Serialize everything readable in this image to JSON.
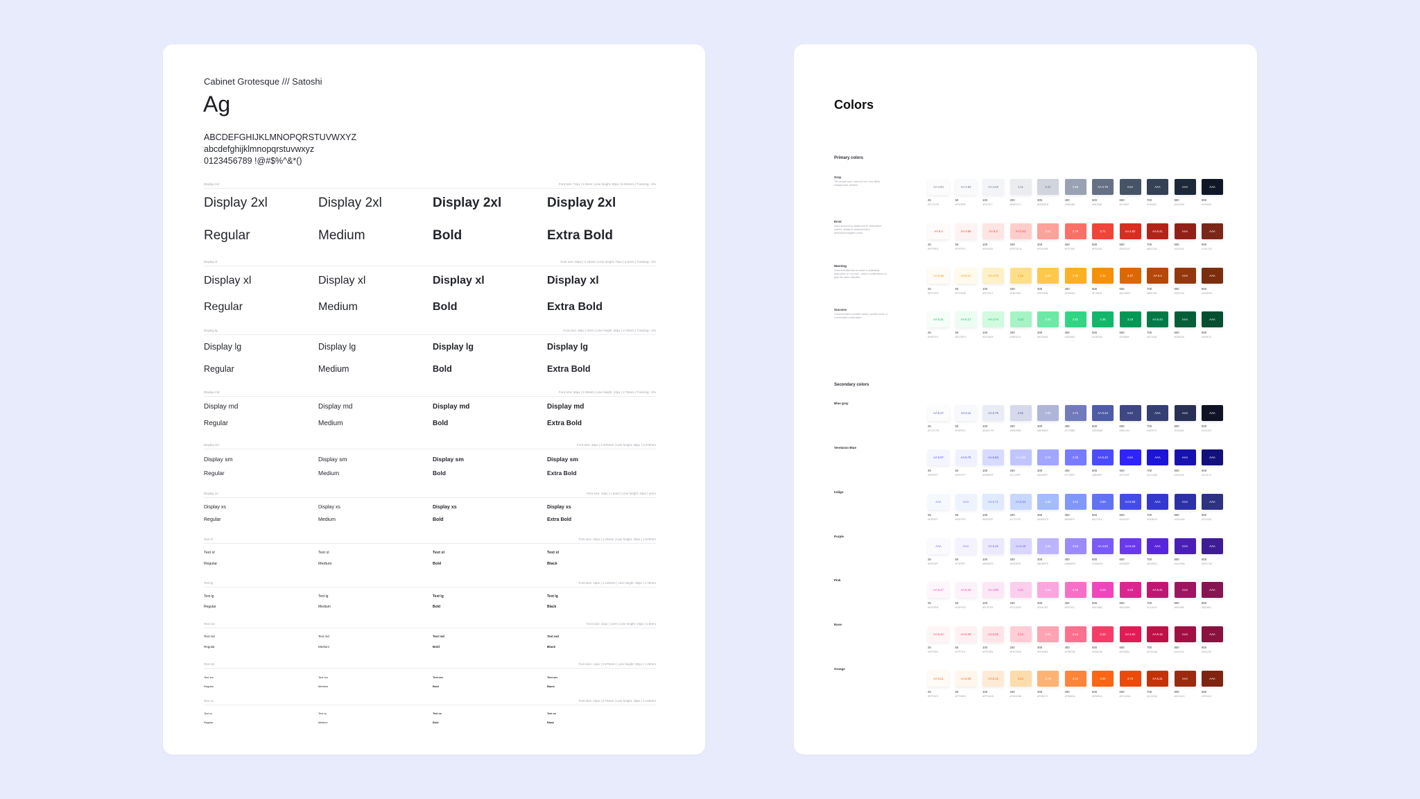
{
  "typography": {
    "font_names": "Cabinet Grotesque /// Satoshi",
    "ag": "Ag",
    "uppercase": "ABCDEFGHIJKLMNOPQRSTUVWXYZ",
    "lowercase": "abcdefghijklmnopqrstuvwxyz",
    "numerals": "0123456789 !@#$%^&*()",
    "specimens": [
      {
        "label": "Display 2xl",
        "meta": "Font size: 72px | 4.5rem | Line height: 90px | 5.625rem | Tracking: -2%",
        "sample": "Display 2xl",
        "weights": [
          "Regular",
          "Medium",
          "Bold",
          "Extra Bold"
        ]
      },
      {
        "label": "Display xl",
        "meta": "Font size: 60px | 3.75rem | Line height: 72px | 4.5rem | Tracking: -2%",
        "sample": "Display xl",
        "weights": [
          "Regular",
          "Medium",
          "Bold",
          "Extra Bold"
        ]
      },
      {
        "label": "Display lg",
        "meta": "Font size: 48px | 3rem | Line height: 60px | 3.75rem | Tracking: -2%",
        "sample": "Display lg",
        "weights": [
          "Regular",
          "Medium",
          "Bold",
          "Extra Bold"
        ]
      },
      {
        "label": "Display md",
        "meta": "Font size: 36px | 2.25rem | Line height: 44px | 2.75rem | Tracking: -2%",
        "sample": "Display md",
        "weights": [
          "Regular",
          "Medium",
          "Bold",
          "Extra Bold"
        ]
      },
      {
        "label": "Display sm",
        "meta": "Font size: 30px | 1.875rem | Line height: 38px | 2.375rem",
        "sample": "Display sm",
        "weights": [
          "Regular",
          "Medium",
          "Bold",
          "Extra Bold"
        ]
      },
      {
        "label": "Display xs",
        "meta": "Font size: 24px | 1.5rem | Line height: 32px | 2rem",
        "sample": "Display xs",
        "weights": [
          "Regular",
          "Medium",
          "Bold",
          "Extra Bold"
        ]
      },
      {
        "label": "Text xl",
        "meta": "Font size: 20px | 1.25rem | Line height: 30px | 1.875rem",
        "sample": "Text xl",
        "weights": [
          "Regular",
          "Medium",
          "Bold",
          "Black"
        ]
      },
      {
        "label": "Text lg",
        "meta": "Font size: 18px | 1.125rem | Line height: 28px | 1.75rem",
        "sample": "Text lg",
        "weights": [
          "Regular",
          "Medium",
          "Bold",
          "Black"
        ]
      },
      {
        "label": "Text md",
        "meta": "Font size: 16px | 1rem | Line height: 24px | 1.5rem",
        "sample": "Text md",
        "weights": [
          "Regular",
          "Medium",
          "Bold",
          "Black"
        ]
      },
      {
        "label": "Text sm",
        "meta": "Font size: 14px | 0.875rem | Line height: 20px | 1.25rem",
        "sample": "Text sm",
        "weights": [
          "Regular",
          "Medium",
          "Bold",
          "Black"
        ]
      },
      {
        "label": "Text xs",
        "meta": "Font size: 12px | 0.75rem | Line height: 18px | 1.125rem",
        "sample": "Text xs",
        "weights": [
          "Regular",
          "Medium",
          "Bold",
          "Black"
        ]
      }
    ]
  },
  "colors": {
    "title": "Colors",
    "steps": [
      "25",
      "50",
      "100",
      "200",
      "300",
      "400",
      "500",
      "600",
      "700",
      "800",
      "900"
    ],
    "primary_label": "Primary colors",
    "secondary_label": "Secondary colors",
    "primary": [
      {
        "name": "Gray",
        "desc": "The neutral color. Used for text, form fields, backgrounds, dividers.",
        "hex": [
          "#FCFCFD",
          "#F9FAFB",
          "#F2F4F7",
          "#EAECF0",
          "#D0D5DD",
          "#98A2B3",
          "#667085",
          "#475467",
          "#344054",
          "#1D2939",
          "#101828"
        ],
        "tags": [
          "AA 4.94",
          "AA 4.83",
          "AA 4.43",
          "4.11",
          "3.41",
          "2.55",
          "AA 4.78",
          "AAA",
          "AAA",
          "AAA",
          "AAA"
        ]
      },
      {
        "name": "Error",
        "desc": "Used across error states and in \"destructive\" actions, ideally to communicate a destructive/negative action.",
        "hex": [
          "#FFFBFA",
          "#FEF3F2",
          "#FEE4E2",
          "#FECDCA",
          "#FDA29B",
          "#F97066",
          "#F04438",
          "#D92D20",
          "#B42318",
          "#912018",
          "#7A271A"
        ],
        "tags": [
          "AA 5.4",
          "AA 4.86",
          "AA 5.3",
          "AA 4.53",
          "3.61",
          "2.78",
          "3.71",
          "AA 4.82",
          "AA 6.41",
          "AAA",
          "AAA"
        ]
      },
      {
        "name": "Warning",
        "desc": "Communicates that an action is potentially destructive or \"on-hold\". Used in confirmations to grab the users' attention.",
        "hex": [
          "#FFFCF5",
          "#FFFAEB",
          "#FEF0C7",
          "#FEDF89",
          "#FEC84B",
          "#FDB022",
          "#F79009",
          "#DC6803",
          "#B54708",
          "#93370D",
          "#7A2E0E"
        ],
        "tags": [
          "AA 5.38",
          "AA 5.17",
          "AA 4.73",
          "4.15",
          "3.46",
          "2.96",
          "2.31",
          "3.47",
          "AA 5.4",
          "AAA",
          "AAA"
        ]
      },
      {
        "name": "Success",
        "desc": "Communicates a positive action, positive trend, or a successful confirmation.",
        "hex": [
          "#F6FEF9",
          "#ECFDF3",
          "#D1FADF",
          "#A6F4C5",
          "#6CE9A6",
          "#32D583",
          "#12B76A",
          "#039855",
          "#027A48",
          "#05603A",
          "#054F31"
        ],
        "tags": [
          "AA 5.31",
          "AA 5.17",
          "AA 4.74",
          "4.22",
          "3.43",
          "2.81",
          "2.45",
          "3.16",
          "AA 5.44",
          "AAA",
          "AAA"
        ]
      }
    ],
    "secondary": [
      {
        "name": "Blue gray",
        "hex": [
          "#FCFCFD",
          "#F8F9FC",
          "#EAECF5",
          "#D5D9EB",
          "#AFB5D9",
          "#717BBC",
          "#4E5BA6",
          "#3E4784",
          "#363F72",
          "#293056",
          "#101323"
        ],
        "tags": [
          "AA 6.27",
          "AA 6.11",
          "AA 5.79",
          "4.61",
          "3.51",
          "4.71",
          "AA 5.34",
          "AAA",
          "AAA",
          "AAA",
          "AAA"
        ]
      },
      {
        "name": "Verelasso Blue",
        "hex": [
          "#F5F5FF",
          "#EFF1FF",
          "#D8DBFF",
          "#C1C5FF",
          "#A2A6FF",
          "#777BFF",
          "#4B4BFF",
          "#2F23FF",
          "#1C14D6",
          "#1812AF",
          "#12117C"
        ],
        "tags": [
          "AA 5.97",
          "AA 6.79",
          "AA 5.63",
          "AA 4.65",
          "3.74",
          "3.35",
          "AA 5.40",
          "AAA",
          "AAA",
          "AAA",
          "AAA"
        ]
      },
      {
        "name": "Indigo",
        "hex": [
          "#F5F8FF",
          "#EEF4FF",
          "#E0EAFF",
          "#C7D7FE",
          "#A4BCFD",
          "#8098F9",
          "#6172F3",
          "#444CE7",
          "#3538CD",
          "#2D31A6",
          "#2D3282"
        ],
        "tags": [
          "AAA",
          "AAA",
          "AA 6.71",
          "AA 5.63",
          "3.88",
          "3.11",
          "3.69",
          "AA 6.03",
          "AAA",
          "AAA",
          "AAA"
        ]
      },
      {
        "name": "Purple",
        "hex": [
          "#FAFAFF",
          "#F4F3FF",
          "#EBE9FE",
          "#D9D6FE",
          "#BDB4FE",
          "#9B8AFB",
          "#7A5AF8",
          "#6938EF",
          "#5925DC",
          "#4A1FB8",
          "#3E1C96"
        ],
        "tags": [
          "AAA",
          "AAA",
          "AA 6.45",
          "AA 5.49",
          "3.91",
          "3.84",
          "AA 4.63",
          "AA 6.19",
          "AAA",
          "AAA",
          "AAA"
        ]
      },
      {
        "name": "Pink",
        "hex": [
          "#FEF6FB",
          "#FDF2FA",
          "#FCE7F6",
          "#FCCEEE",
          "#FAA7E0",
          "#F670C7",
          "#EE46BC",
          "#DD2590",
          "#C11574",
          "#9E165F",
          "#851651"
        ],
        "tags": [
          "AA 5.47",
          "AA 5.33",
          "AA 4.98",
          "4.21",
          "3.65",
          "3.45",
          "3.29",
          "4.43",
          "AA 5.41",
          "AAA",
          "AAA"
        ]
      },
      {
        "name": "Rose",
        "hex": [
          "#FFF5F6",
          "#FFF1F3",
          "#FFE4E8",
          "#FECDD6",
          "#FEA3B4",
          "#FD6F8E",
          "#F63D68",
          "#E31B54",
          "#C01048",
          "#A11043",
          "#89123E"
        ],
        "tags": [
          "AA 6.42",
          "AA 5.29",
          "AA 6.06",
          "4.12",
          "3.65",
          "3.44",
          "3.46",
          "AA 4.61",
          "AA 6.15",
          "AAA",
          "AAA"
        ]
      },
      {
        "name": "Orange",
        "hex": [
          "#FFFAF5",
          "#FFF6ED",
          "#FFEAD5",
          "#FDDCAB",
          "#FEB273",
          "#FD853A",
          "#FB6514",
          "#EC4A0A",
          "#C4320A",
          "#9C2A10",
          "#7E2410"
        ],
        "tags": [
          "AA 6.21",
          "AA 6.05",
          "AA 6.12",
          "4.21",
          "3.78",
          "3.44",
          "3.05",
          "3.73",
          "AA 6.31",
          "AAA",
          "AAA"
        ]
      }
    ]
  }
}
